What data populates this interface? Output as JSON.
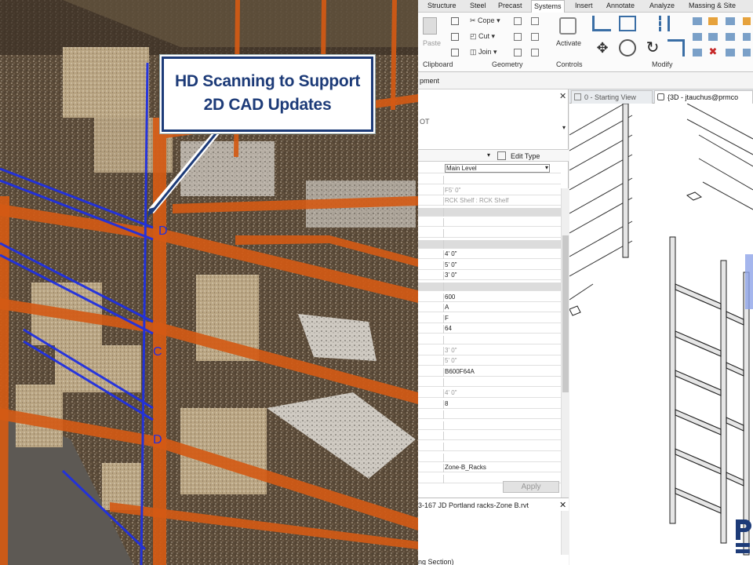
{
  "callout": {
    "line1": "HD Scanning to Support",
    "line2": "2D CAD Updates"
  },
  "scan_labels": {
    "d_upper": "D",
    "c_mid": "C",
    "d_lower": "D"
  },
  "ribbon_tabs": [
    "Structure",
    "Steel",
    "Precast",
    "Systems",
    "Insert",
    "Annotate",
    "Analyze",
    "Massing & Site"
  ],
  "ribbon": {
    "paste": "Paste",
    "cope": "Cope",
    "cut": "Cut",
    "join": "Join",
    "activate": "Activate",
    "groups": {
      "clipboard": "Clipboard",
      "geometry": "Geometry",
      "controls": "Controls",
      "modify": "Modify"
    }
  },
  "subbar": {
    "label": "pment"
  },
  "properties": {
    "type_fragment": "OT",
    "edit_type": "Edit Type",
    "level_value": "Main Level",
    "rows": [
      "",
      "F5' 0\"",
      "RCK Shelf : RCK Shelf",
      "",
      "",
      "",
      "",
      "4' 0\"",
      "5' 0\"",
      "3' 0\"",
      "",
      "600",
      "A",
      "F",
      "64",
      "",
      "3' 0\"",
      "5' 0\"",
      "B600F64A",
      "",
      "4' 0\"",
      "8",
      "",
      "",
      "",
      "",
      "",
      "Zone-B_Racks",
      ""
    ],
    "apply": "Apply"
  },
  "view_tabs": {
    "starting": "0 - Starting View",
    "active": "{3D - jtauchus@prmco"
  },
  "browser": {
    "file": "3-167 JD Portland racks-Zone B.rvt",
    "section": "ng Section)"
  },
  "colors": {
    "callout_border": "#1d3b78",
    "rack_orange": "#d45a14",
    "scan_blue": "#2030e0"
  }
}
